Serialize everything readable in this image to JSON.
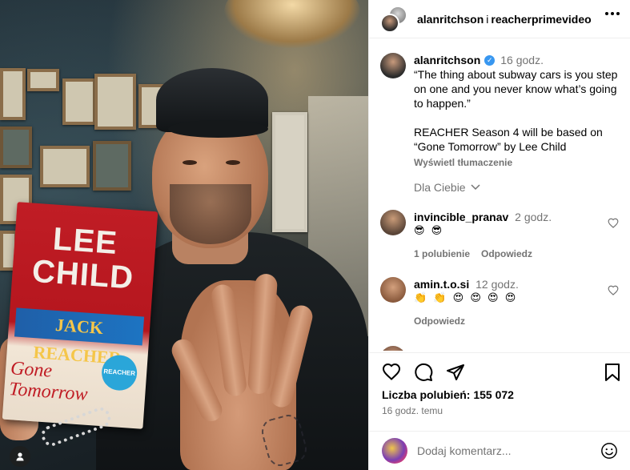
{
  "photo": {
    "book": {
      "author": "LEE CHILD",
      "series": "JACK REACHER",
      "title": "Gone Tomorrow",
      "badge": "REACHER"
    }
  },
  "header": {
    "user1": "alanritchson",
    "separator": "i",
    "user2": "reacherprimevideo"
  },
  "caption": {
    "username": "alanritchson",
    "time": "16 godz.",
    "lines": [
      "“The thing about subway cars is you step on one and you never know what’s going to happen.”",
      "REACHER Season 4 will be based on “Gone Tomorrow” by Lee Child"
    ],
    "translate": "Wyświetl tłumaczenie"
  },
  "for_you": "Dla Ciebie",
  "comments": [
    {
      "username": "invincible_pranav",
      "time": "2 godz.",
      "text": "😎 😎",
      "likes": "1 polubienie",
      "reply": "Odpowiedz"
    },
    {
      "username": "amin.t.o.si",
      "time": "12 godz.",
      "text": "👏 👏 😍 😍 😍 😍",
      "reply": "Odpowiedz"
    }
  ],
  "footer": {
    "likes": "Liczba polubień: 155 072",
    "posted": "16 godz. temu",
    "comment_placeholder": "Dodaj komentarz..."
  },
  "colors": {
    "verified": "#3897f0",
    "muted": "#737373",
    "book_red": "#c01d25"
  }
}
